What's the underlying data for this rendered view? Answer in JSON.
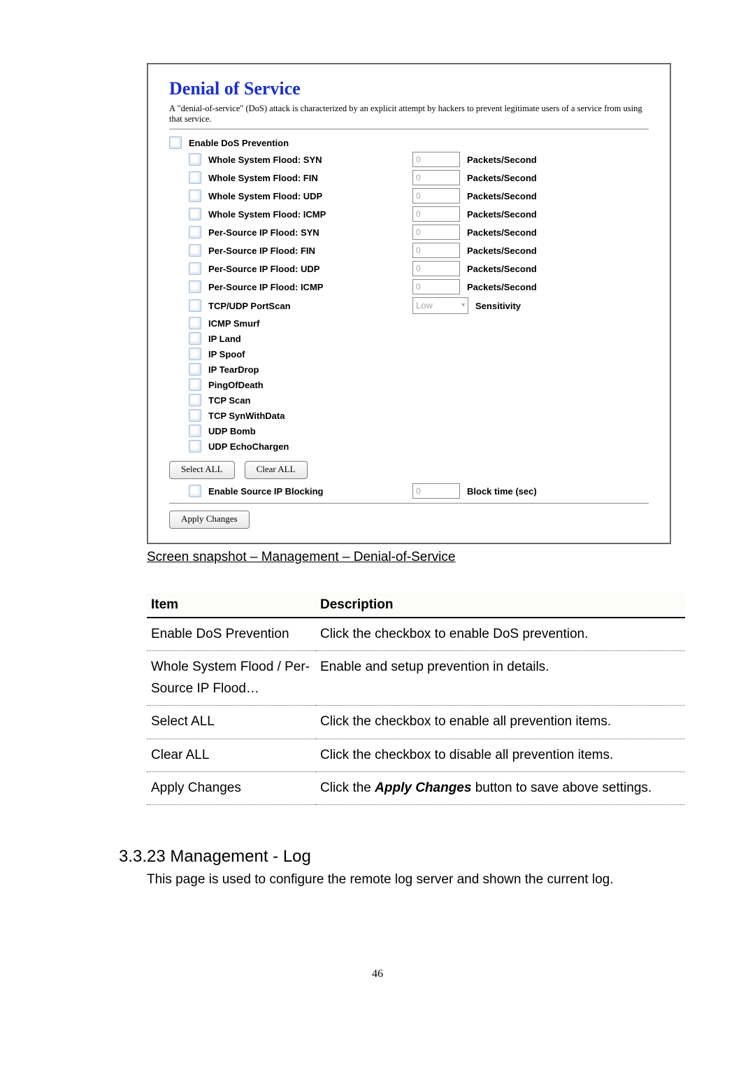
{
  "panel": {
    "title": "Denial of Service",
    "description": "A \"denial-of-service\" (DoS) attack is characterized by an explicit attempt by hackers to prevent legitimate users of a service from using that service.",
    "enable_label": "Enable DoS Prevention",
    "thresholds": [
      {
        "label": "Whole System Flood: SYN",
        "value": "0",
        "unit": "Packets/Second"
      },
      {
        "label": "Whole System Flood: FIN",
        "value": "0",
        "unit": "Packets/Second"
      },
      {
        "label": "Whole System Flood: UDP",
        "value": "0",
        "unit": "Packets/Second"
      },
      {
        "label": "Whole System Flood: ICMP",
        "value": "0",
        "unit": "Packets/Second"
      },
      {
        "label": "Per-Source IP Flood: SYN",
        "value": "0",
        "unit": "Packets/Second"
      },
      {
        "label": "Per-Source IP Flood: FIN",
        "value": "0",
        "unit": "Packets/Second"
      },
      {
        "label": "Per-Source IP Flood: UDP",
        "value": "0",
        "unit": "Packets/Second"
      },
      {
        "label": "Per-Source IP Flood: ICMP",
        "value": "0",
        "unit": "Packets/Second"
      }
    ],
    "portscan": {
      "label": "TCP/UDP PortScan",
      "level": "Low",
      "unit": "Sensitivity"
    },
    "flags": [
      "ICMP Smurf",
      "IP Land",
      "IP Spoof",
      "IP TearDrop",
      "PingOfDeath",
      "TCP Scan",
      "TCP SynWithData",
      "UDP Bomb",
      "UDP EchoChargen"
    ],
    "select_all_btn": "Select ALL",
    "clear_all_btn": "Clear ALL",
    "source_ip_block_label": "Enable Source IP Blocking",
    "block_time_value": "0",
    "block_time_unit": "Block time (sec)",
    "apply_btn": "Apply Changes"
  },
  "caption": "Screen snapshot – Management – Denial-of-Service",
  "table": {
    "head_item": "Item",
    "head_desc": "Description",
    "rows": [
      {
        "item": "Enable DoS Prevention",
        "desc": "Click the checkbox to enable DoS prevention."
      },
      {
        "item": "Whole System Flood / Per-Source IP Flood…",
        "desc": "Enable and setup prevention in details."
      },
      {
        "item": "Select ALL",
        "desc": "Click the checkbox to enable all prevention items."
      },
      {
        "item": "Clear ALL",
        "desc": "Click the checkbox to disable all prevention items."
      }
    ],
    "apply_item": "Apply Changes",
    "apply_prefix": "Click the ",
    "apply_bold": "Apply Changes",
    "apply_suffix": " button to save above settings."
  },
  "section": {
    "number": "3.3.23",
    "title": "Management - Log",
    "body": "This page is used to configure the remote log server and shown the current log."
  },
  "page_number": "46"
}
